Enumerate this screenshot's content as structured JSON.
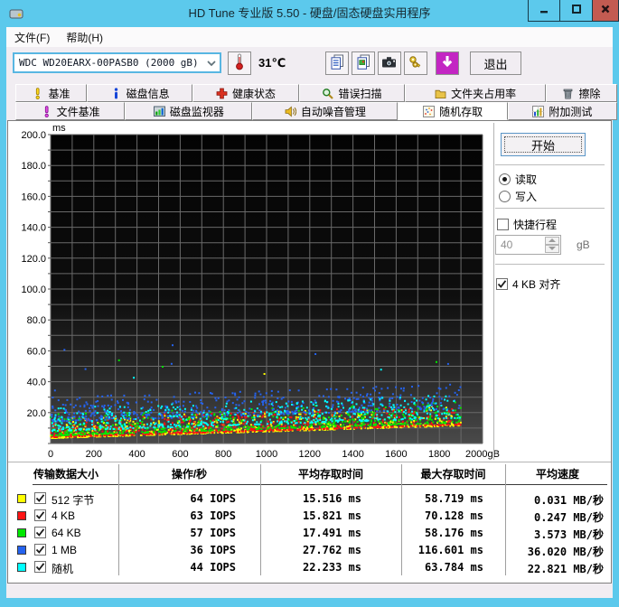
{
  "window": {
    "title": "HD Tune 专业版 5.50 - 硬盘/固态硬盘实用程序"
  },
  "menu": {
    "items": [
      "文件(F)",
      "帮助(H)"
    ]
  },
  "toolbar": {
    "drive": "WDC WD20EARX-00PASB0 (2000 gB)",
    "temperature": "31℃",
    "exit_label": "退出",
    "buttons": [
      {
        "name": "copy-text-button",
        "icon": "copy-text-icon"
      },
      {
        "name": "copy-image-button",
        "icon": "copy-image-icon"
      },
      {
        "name": "screenshot-button",
        "icon": "camera-icon"
      },
      {
        "name": "options-button",
        "icon": "keys-icon"
      },
      {
        "name": "update-button",
        "icon": "update-arrow-icon",
        "accent": true
      }
    ]
  },
  "tabs": {
    "row1": [
      {
        "label": "基准",
        "icon": "benchmark-icon"
      },
      {
        "label": "磁盘信息",
        "icon": "disk-info-icon"
      },
      {
        "label": "健康状态",
        "icon": "health-icon"
      },
      {
        "label": "错误扫描",
        "icon": "error-scan-icon"
      },
      {
        "label": "文件夹占用率",
        "icon": "folder-usage-icon"
      },
      {
        "label": "擦除",
        "icon": "erase-icon"
      }
    ],
    "row2": [
      {
        "label": "文件基准",
        "icon": "file-benchmark-icon"
      },
      {
        "label": "磁盘监视器",
        "icon": "disk-monitor-icon"
      },
      {
        "label": "自动噪音管理",
        "icon": "aam-icon"
      },
      {
        "label": "随机存取",
        "icon": "random-access-icon",
        "active": true
      },
      {
        "label": "附加测试",
        "icon": "extra-tests-icon"
      }
    ]
  },
  "controls": {
    "start_label": "开始",
    "read_label": "读取",
    "write_label": "写入",
    "read_selected": true,
    "short_stroke_label": "快捷行程",
    "short_stroke_checked": false,
    "capacity_value": "40",
    "capacity_unit": "gB",
    "align_label": "4 KB 对齐",
    "align_checked": true
  },
  "chart_data": {
    "type": "scatter",
    "title": "",
    "xlabel": "gB",
    "ylabel": "ms",
    "xlim": [
      0,
      2000
    ],
    "ylim": [
      0,
      200
    ],
    "x_tick_step": 200,
    "y_tick_step": 20,
    "grid": true,
    "legend_position": "table-below",
    "x_data_max": 1900,
    "seed": 1337,
    "series": [
      {
        "name": "512 字节",
        "color": "#ffff00",
        "count": 680,
        "band_start": 3.5,
        "band_end": 12,
        "spread": 13,
        "shape": 2.8,
        "outlier_rate": 0.003,
        "outlier_extra": 30,
        "avg_ms": 15.516,
        "max_ms": 58.719
      },
      {
        "name": "4 KB",
        "color": "#ff1414",
        "count": 600,
        "band_start": 4,
        "band_end": 12.5,
        "spread": 13,
        "shape": 2.6,
        "outlier_rate": 0.004,
        "outlier_extra": 40,
        "avg_ms": 15.821,
        "max_ms": 70.128
      },
      {
        "name": "64 KB",
        "color": "#00e800",
        "count": 540,
        "band_start": 5,
        "band_end": 14,
        "spread": 14,
        "shape": 2.4,
        "outlier_rate": 0.005,
        "outlier_extra": 42,
        "avg_ms": 17.491,
        "max_ms": 58.176
      },
      {
        "name": "1 MB",
        "color": "#2563ef",
        "count": 520,
        "band_start": 14,
        "band_end": 23,
        "spread": 16,
        "shape": 1.7,
        "outlier_rate": 0.008,
        "outlier_extra": 38,
        "avg_ms": 27.762,
        "max_ms": 116.601
      },
      {
        "name": "随机",
        "color": "#00ffff",
        "count": 500,
        "band_start": 8,
        "band_end": 17,
        "spread": 15,
        "shape": 2.0,
        "outlier_rate": 0.006,
        "outlier_extra": 33,
        "avg_ms": 22.233,
        "max_ms": 63.784
      }
    ]
  },
  "table": {
    "headers": [
      "传输数据大小",
      "操作/秒",
      "平均存取时间",
      "最大存取时间",
      "平均速度"
    ],
    "rows": [
      {
        "color": "#ffff00",
        "label": "512 字节",
        "checked": true,
        "iops": "64 IOPS",
        "avg_access": "15.516 ms",
        "max_access": "58.719 ms",
        "avg_speed": "0.031 MB/秒"
      },
      {
        "color": "#ff1414",
        "label": "4 KB",
        "checked": true,
        "iops": "63 IOPS",
        "avg_access": "15.821 ms",
        "max_access": "70.128 ms",
        "avg_speed": "0.247 MB/秒"
      },
      {
        "color": "#00e800",
        "label": "64 KB",
        "checked": true,
        "iops": "57 IOPS",
        "avg_access": "17.491 ms",
        "max_access": "58.176 ms",
        "avg_speed": "3.573 MB/秒"
      },
      {
        "color": "#2563ef",
        "label": "1 MB",
        "checked": true,
        "iops": "36 IOPS",
        "avg_access": "27.762 ms",
        "max_access": "116.601 ms",
        "avg_speed": "36.020 MB/秒"
      },
      {
        "color": "#00ffff",
        "label": "随机",
        "checked": true,
        "iops": "44 IOPS",
        "avg_access": "22.233 ms",
        "max_access": "63.784 ms",
        "avg_speed": "22.821 MB/秒"
      }
    ]
  }
}
